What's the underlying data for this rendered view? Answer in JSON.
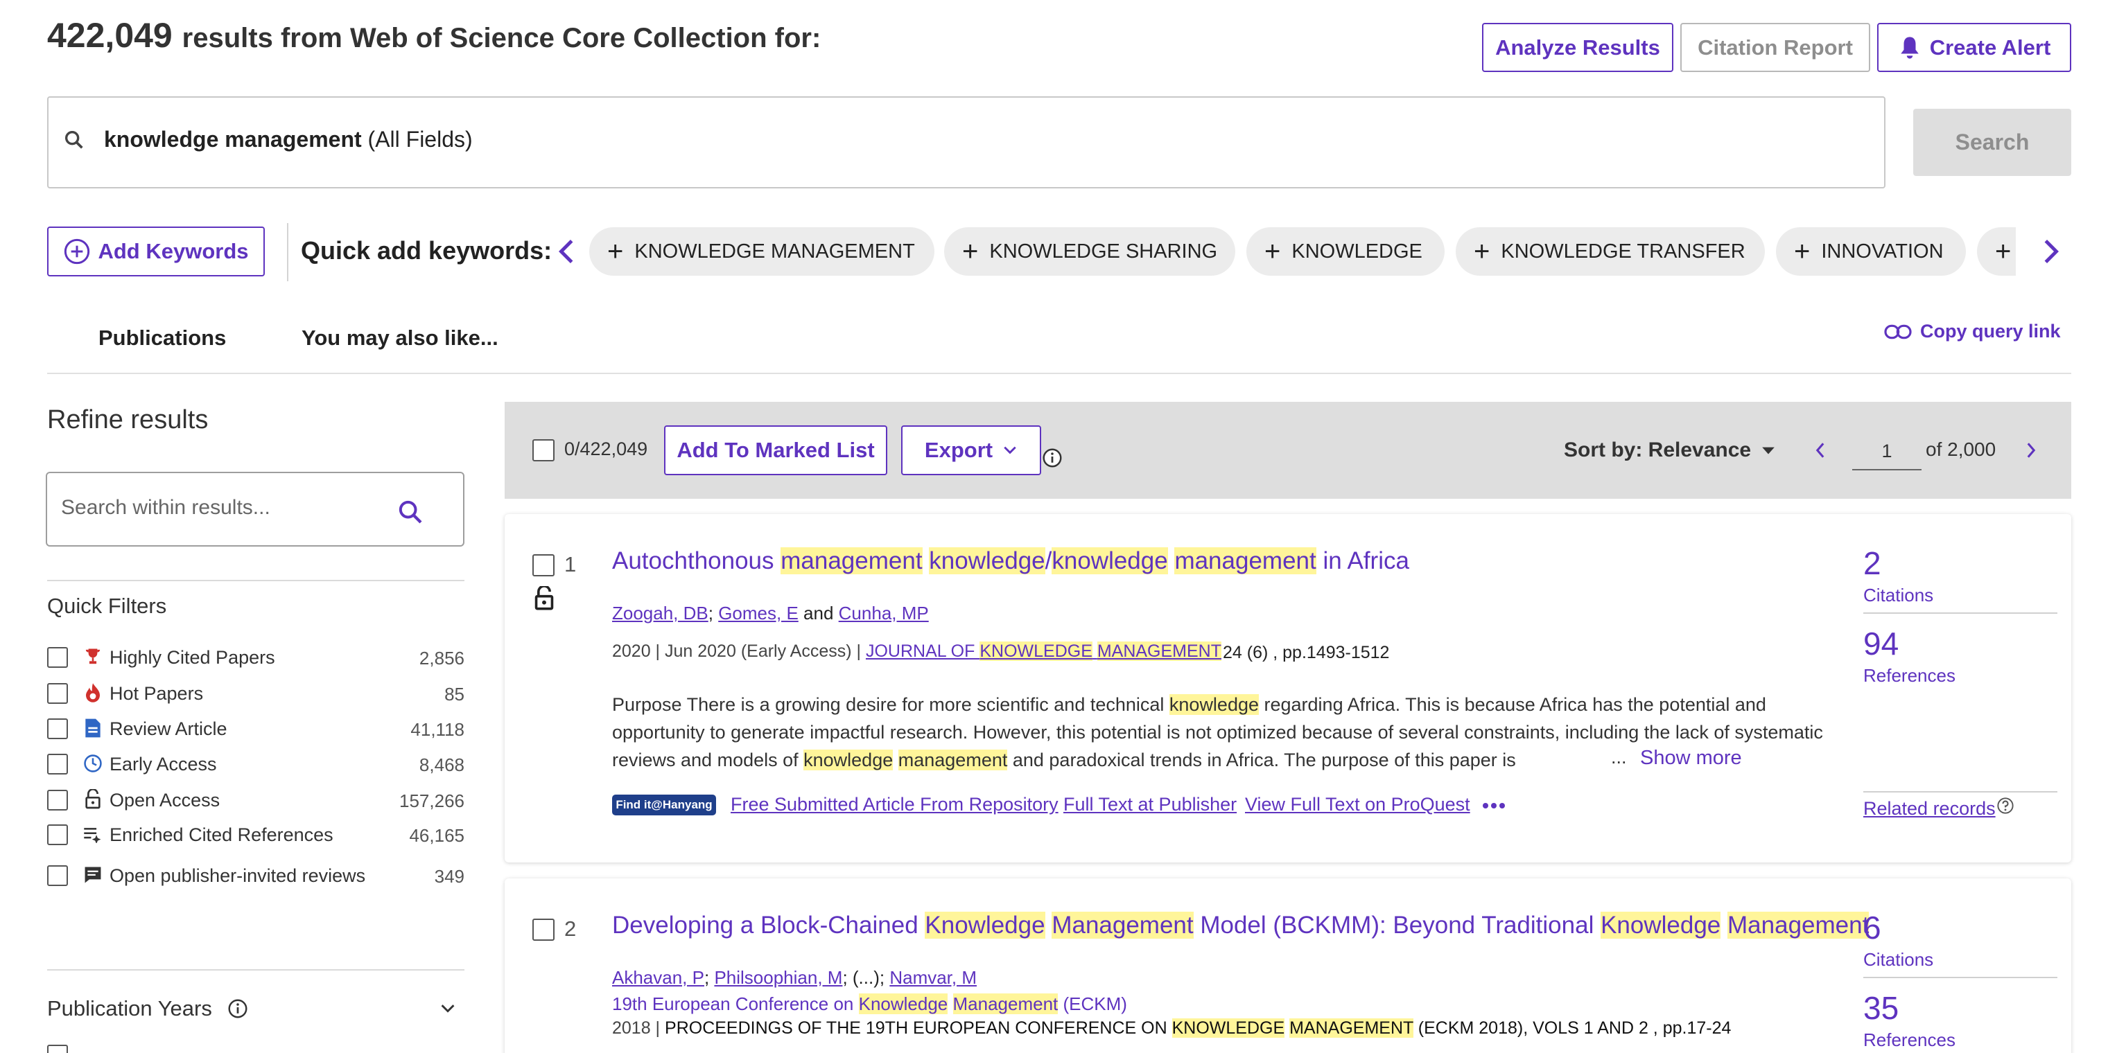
{
  "header": {
    "result_count": "422,049",
    "result_suffix": "results from Web of Science Core Collection for:",
    "analyze_label": "Analyze Results",
    "citation_report_label": "Citation Report",
    "create_alert_label": "Create Alert"
  },
  "search": {
    "query": "knowledge management",
    "field": "(All Fields)",
    "button_label": "Search"
  },
  "keywords": {
    "add_label": "Add Keywords",
    "quick_add_label": "Quick add keywords:",
    "chips": [
      "KNOWLEDGE MANAGEMENT",
      "KNOWLEDGE SHARING",
      "KNOWLEDGE",
      "KNOWLEDGE TRANSFER",
      "INNOVATION"
    ]
  },
  "tabs": {
    "publications": "Publications",
    "also_like": "You may also like...",
    "copy_query": "Copy query link"
  },
  "sidebar": {
    "refine_title": "Refine results",
    "within_placeholder": "Search within results...",
    "quick_filters_title": "Quick Filters",
    "filters": [
      {
        "label": "Highly Cited Papers",
        "count": "2,856",
        "icon": "trophy-icon"
      },
      {
        "label": "Hot Papers",
        "count": "85",
        "icon": "flame-icon"
      },
      {
        "label": "Review Article",
        "count": "41,118",
        "icon": "document-icon"
      },
      {
        "label": "Early Access",
        "count": "8,468",
        "icon": "clock-icon"
      },
      {
        "label": "Open Access",
        "count": "157,266",
        "icon": "lock-open-icon"
      },
      {
        "label": "Enriched Cited References",
        "count": "46,165",
        "icon": "list-enriched-icon"
      },
      {
        "label": "Open publisher-invited reviews",
        "count": "349",
        "icon": "comment-icon"
      }
    ],
    "pub_years_title": "Publication Years"
  },
  "toolbar": {
    "selected": "0/422,049",
    "marked_label": "Add To Marked List",
    "export_label": "Export",
    "sort_label": "Sort by: Relevance",
    "page": "1",
    "of_pages": "of  2,000"
  },
  "results": [
    {
      "num": "1",
      "title_parts": [
        "Autochthonous ",
        "management",
        " ",
        "knowledge",
        "/",
        "knowledge",
        " ",
        "management",
        " in Africa"
      ],
      "authors": [
        "Zoogah, DB",
        "Gomes, E",
        "Cunha, MP"
      ],
      "authors_and": "and",
      "date": "2020 | Jun 2020 (Early Access) | ",
      "journal_parts": [
        "JOURNAL OF ",
        "KNOWLEDGE",
        " ",
        "MANAGEMENT"
      ],
      "volume": "24 (6) , pp.1493-1512",
      "abstract_parts": [
        "Purpose There is a growing desire for more scientific and technical ",
        "knowledge",
        " regarding Africa. This is because Africa has the potential and opportunity to generate impactful research. However, this potential is not optimized because of several constraints, including the lack of systematic reviews and models of ",
        "knowledge",
        " ",
        "management",
        " and paradoxical trends in Africa. The purpose of this paper is"
      ],
      "ellipsis": "...",
      "show_more": "Show more",
      "find_it": "Find it@Hanyang",
      "links": [
        "Free Submitted Article From Repository",
        "Full Text at Publisher",
        "View Full Text on ProQuest"
      ],
      "citations": "2",
      "citations_label": "Citations",
      "references": "94",
      "references_label": "References",
      "related": "Related records"
    },
    {
      "num": "2",
      "title_parts": [
        "Developing a Block-Chained ",
        "Knowledge",
        " ",
        "Management",
        " Model (BCKMM): Beyond Traditional ",
        "Knowledge",
        " ",
        "Management"
      ],
      "authors": [
        "Akhavan, P",
        "Philsoophian, M",
        "Namvar, M"
      ],
      "authors_mid": "; (...); ",
      "conference_parts": [
        "19th European Conference on ",
        "Knowledge",
        " ",
        "Management",
        " (ECKM)"
      ],
      "proceedings_year": "2018 | ",
      "proceedings_parts": [
        "PROCEEDINGS OF THE 19TH EUROPEAN CONFERENCE ON ",
        "KNOWLEDGE",
        " ",
        "MANAGEMENT",
        " (ECKM 2018), VOLS 1 AND 2 , pp.17-24"
      ],
      "citations": "6",
      "citations_label": "Citations",
      "references": "35",
      "references_label": "References"
    }
  ],
  "colors": {
    "accent": "#5e33bf",
    "highlight": "#fff59a",
    "toolbar_bg": "#dedede"
  }
}
